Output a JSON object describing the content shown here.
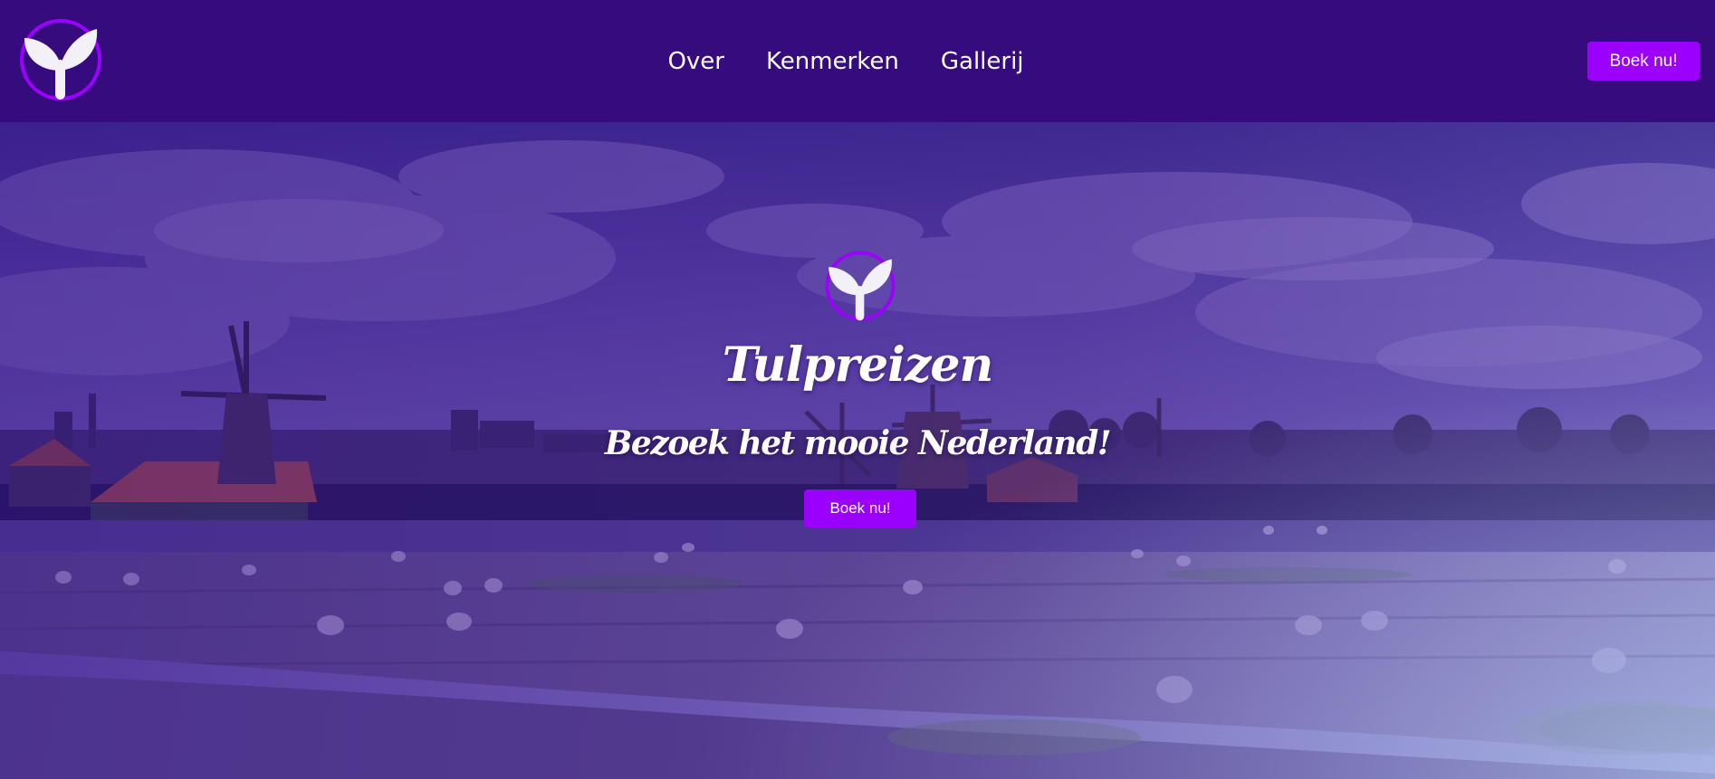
{
  "brand": {
    "logo_icon": "sprout-icon"
  },
  "nav": {
    "links": [
      "Over",
      "Kenmerken",
      "Gallerij"
    ],
    "cta_label": "Boek nu!"
  },
  "hero": {
    "logo_icon": "sprout-icon",
    "title": "Tulpreizen",
    "subtitle": "Bezoek het mooie Nederland!",
    "cta_label": "Boek nu!",
    "background": "windmill-landscape-photo"
  },
  "colors": {
    "navbar_bg": "#350b7e",
    "accent": "#9b00ff",
    "text": "#ffffff"
  }
}
